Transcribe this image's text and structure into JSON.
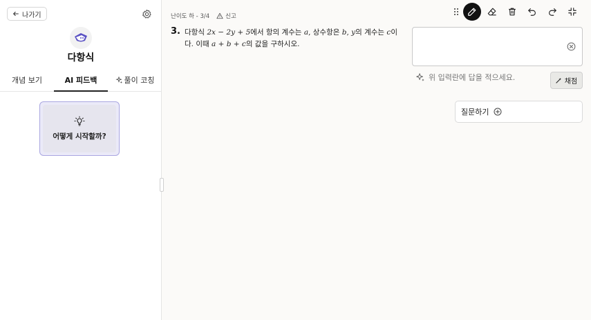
{
  "sidebar": {
    "back_label": "나가기",
    "topic_title": "다항식",
    "tabs": [
      {
        "label": "개념 보기",
        "active": false
      },
      {
        "label": "AI 피드백",
        "active": true
      },
      {
        "label": "풀이 코칭",
        "active": false
      }
    ],
    "hint_card_label": "어떻게 시작할까?"
  },
  "problem": {
    "meta_text": "난이도 하 - 3/4",
    "report_label": "신고",
    "number": "3.",
    "text_parts": {
      "p1": "다항식 ",
      "expr1": "2x − 2y + 5",
      "p2": "에서 항의 계수는 ",
      "a": "a",
      "p3": ", 상수항은 ",
      "b": "b",
      "p4": ", ",
      "y": "y",
      "p5": "의 계수는 ",
      "c": "c",
      "p6": "이다. 이때 ",
      "expr2": "a + b + c",
      "p7": "의 값을 구하시오."
    }
  },
  "answer": {
    "value": "",
    "helper_text": "위 입력란에 답을 적으세요.",
    "grade_label": "채점",
    "ask_label": "질문하기"
  },
  "toolbar": {
    "tools": [
      "drag-handle-icon",
      "pen-icon",
      "eraser-icon",
      "trash-icon",
      "undo-icon",
      "redo-icon",
      "collapse-icon"
    ],
    "active_tool": "pen-icon"
  },
  "colors": {
    "accent": "#5b52c4",
    "hint_border": "#a9a6e0",
    "hint_bg": "#ebeaf8"
  }
}
